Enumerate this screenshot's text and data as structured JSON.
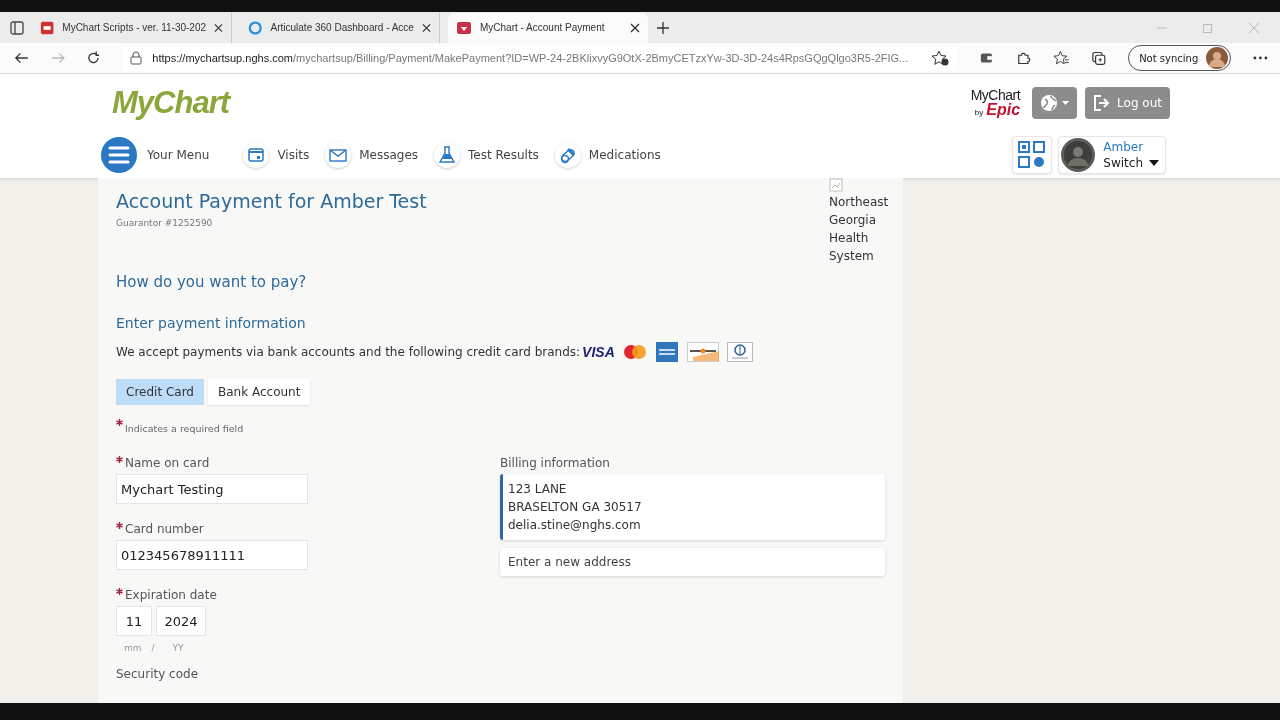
{
  "browser": {
    "tabs": [
      {
        "title": "MyChart Scripts - ver. 11-30-202",
        "kind": "pdf",
        "selected": false
      },
      {
        "title": "Articulate 360 Dashboard - Acce",
        "kind": "ring",
        "selected": false
      },
      {
        "title": "MyChart - Account Payment",
        "kind": "mychart",
        "selected": true
      }
    ],
    "url_host": "https://mychartsup.nghs.com",
    "url_path": "/mychartsup/Billing/Payment/MakePayment?ID=WP-24-2BKlixvyG9OtX-2BmyCETzxYw-3D-3D-24s4RpsGQgQlgo3R5-2FIG...",
    "sync_label": "Not syncing"
  },
  "header": {
    "logo": "MyChart",
    "epic_top": "MyChart",
    "epic_by": "by",
    "epic_brand": "Epic",
    "logout": "Log out"
  },
  "nav": {
    "menu_label": "Your Menu",
    "items": [
      {
        "label": "Visits",
        "kind": "calendar"
      },
      {
        "label": "Messages",
        "kind": "mail"
      },
      {
        "label": "Test Results",
        "kind": "flask"
      },
      {
        "label": "Medications",
        "kind": "pill"
      }
    ],
    "user": {
      "name": "Amber",
      "action": "Switch"
    }
  },
  "content": {
    "title": "Account Payment for Amber Test",
    "guarantor": "Guarantor #1252590",
    "org_image_alt": "Northeast Georgia Health System",
    "question": "How do you want to pay?",
    "section": "Enter payment information",
    "accept_text": "We accept payments via bank accounts and the following credit card brands:",
    "card_brands": [
      {
        "kind": "visa",
        "text": "VISA"
      },
      {
        "kind": "mastercard"
      },
      {
        "kind": "amex"
      },
      {
        "kind": "discover"
      },
      {
        "kind": "diners"
      }
    ],
    "method_tabs": [
      {
        "label": "Credit Card",
        "selected": true
      },
      {
        "label": "Bank Account",
        "selected": false
      }
    ],
    "required_note": "Indicates a required field",
    "fields": [
      {
        "label": "Name on card",
        "required": true,
        "value": "Mychart Testing"
      },
      {
        "label": "Card number",
        "required": true,
        "value": "012345678911111"
      }
    ],
    "expiration": {
      "label": "Expiration date",
      "required": true,
      "month": "11",
      "year": "2024",
      "month_hint": "mm",
      "separator": "/",
      "year_hint": "YY"
    },
    "security_label": "Security code",
    "billing": {
      "label": "Billing information",
      "address_lines": [
        "123 LANE",
        "BRASELTON GA 30517",
        "delia.stine@nghs.com"
      ],
      "new_address": "Enter a new address"
    }
  }
}
